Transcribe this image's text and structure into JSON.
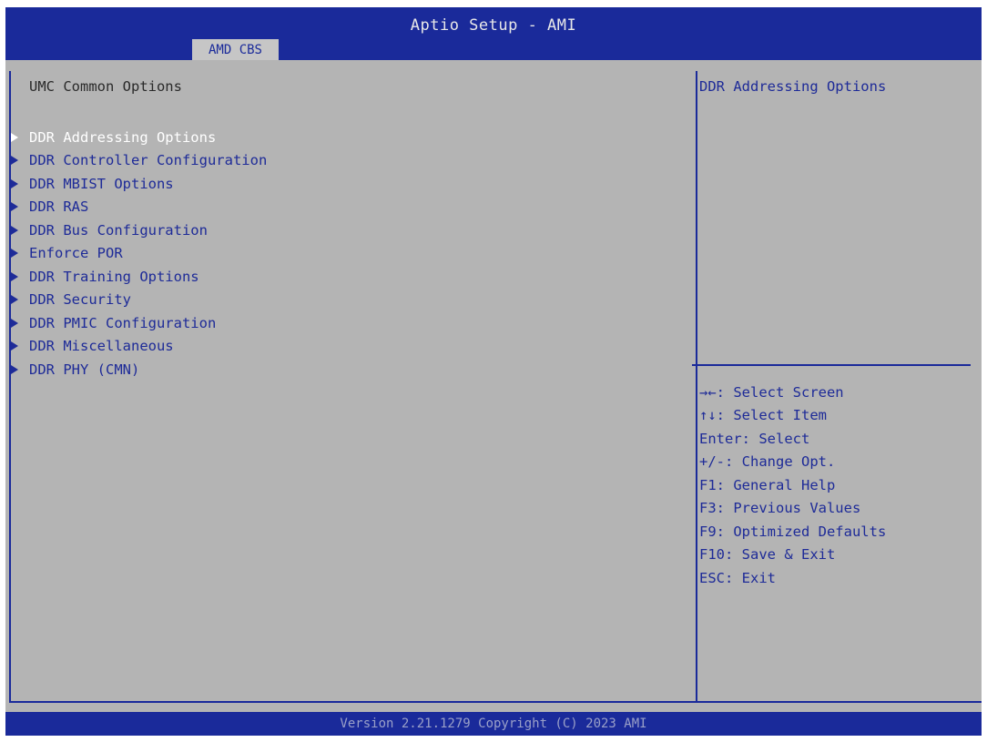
{
  "header": {
    "title": "Aptio Setup - AMI",
    "tabs": [
      {
        "label": "AMD CBS",
        "active": true
      }
    ]
  },
  "main": {
    "section_title": "UMC Common Options",
    "items": [
      {
        "label": "DDR Addressing Options",
        "selected": true
      },
      {
        "label": "DDR Controller Configuration",
        "selected": false
      },
      {
        "label": "DDR MBIST Options",
        "selected": false
      },
      {
        "label": "DDR RAS",
        "selected": false
      },
      {
        "label": "DDR Bus Configuration",
        "selected": false
      },
      {
        "label": "Enforce POR",
        "selected": false
      },
      {
        "label": "DDR Training Options",
        "selected": false
      },
      {
        "label": "DDR Security",
        "selected": false
      },
      {
        "label": "DDR PMIC Configuration",
        "selected": false
      },
      {
        "label": "DDR Miscellaneous",
        "selected": false
      },
      {
        "label": "DDR PHY (CMN)",
        "selected": false
      }
    ]
  },
  "help": {
    "description": "DDR Addressing Options",
    "keys": [
      "→←: Select Screen",
      "↑↓: Select Item",
      "Enter: Select",
      "+/-: Change Opt.",
      "F1: General Help",
      "F3: Previous Values",
      "F9: Optimized Defaults",
      "F10: Save & Exit",
      "ESC: Exit"
    ]
  },
  "footer": {
    "version": "Version 2.21.1279 Copyright (C) 2023 AMI"
  },
  "colors": {
    "header_bg": "#1a2a9a",
    "panel_bg": "#b4b4b4",
    "text_blue": "#1e2b98",
    "selected_text": "#ffffff"
  }
}
